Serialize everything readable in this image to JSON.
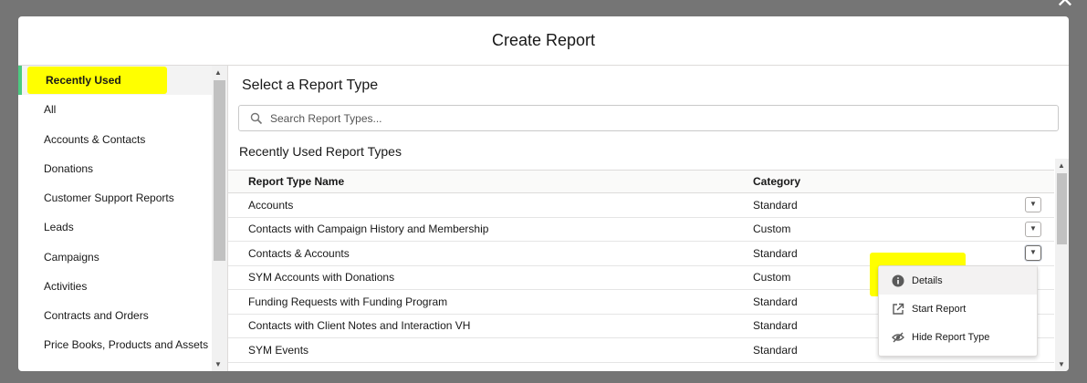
{
  "modal": {
    "title": "Create Report",
    "close_icon": "close-icon"
  },
  "sidebar": {
    "items": [
      {
        "label": "Recently Used",
        "active": true
      },
      {
        "label": "All"
      },
      {
        "label": "Accounts & Contacts"
      },
      {
        "label": "Donations"
      },
      {
        "label": "Customer Support Reports"
      },
      {
        "label": "Leads"
      },
      {
        "label": "Campaigns"
      },
      {
        "label": "Activities"
      },
      {
        "label": "Contracts and Orders"
      },
      {
        "label": "Price Books, Products and Assets"
      }
    ]
  },
  "main": {
    "title": "Select a Report Type",
    "search": {
      "placeholder": "Search Report Types...",
      "value": ""
    },
    "subheading": "Recently Used Report Types",
    "columns": {
      "name": "Report Type Name",
      "category": "Category"
    },
    "rows": [
      {
        "name": "Accounts",
        "category": "Standard"
      },
      {
        "name": "Contacts with Campaign History and Membership",
        "category": "Custom"
      },
      {
        "name": "Contacts & Accounts",
        "category": "Standard"
      },
      {
        "name": "SYM Accounts with Donations",
        "category": "Custom"
      },
      {
        "name": "Funding Requests with Funding Program",
        "category": "Standard"
      },
      {
        "name": "Contacts with Client Notes and Interaction VH",
        "category": "Standard"
      },
      {
        "name": "SYM Events",
        "category": "Standard"
      }
    ]
  },
  "menu": {
    "items": [
      {
        "label": "Details",
        "icon": "info-icon"
      },
      {
        "label": "Start Report",
        "icon": "external-link-icon"
      },
      {
        "label": "Hide Report Type",
        "icon": "hide-eye-icon"
      }
    ]
  },
  "colors": {
    "highlight": "#ffff00",
    "active_accent": "#4bca81",
    "backdrop": "#757575"
  }
}
